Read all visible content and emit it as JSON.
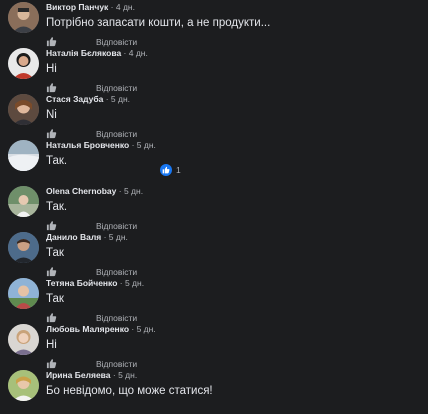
{
  "reply_label": "Відповісти",
  "comments": [
    {
      "author": "Виктор Панчук",
      "time": "4 дн.",
      "text": "Потрібно запасати кошти, а не продукти..."
    },
    {
      "author": "Наталія Бєлякова",
      "time": "4 дн.",
      "text": "Ні"
    },
    {
      "author": "Стася Задуба",
      "time": "5 дн.",
      "text": "Ni"
    },
    {
      "author": "Наталья Бровченко",
      "time": "5 дн.",
      "text": "Так.",
      "reactions": {
        "count": "1",
        "icon": "thumbs-up-icon",
        "color": "#1877f2"
      }
    },
    {
      "author": "Olena Chernobay",
      "time": "5 дн.",
      "text": "Так."
    },
    {
      "author": "Данило Валя",
      "time": "5 дн.",
      "text": "Так"
    },
    {
      "author": "Тетяна Бойченко",
      "time": "5 дн.",
      "text": "Так"
    },
    {
      "author": "Любовь Маляренко",
      "time": "5 дн.",
      "text": "Ні"
    },
    {
      "author": "Ирина Беляева",
      "time": "5 дн.",
      "text": "Бо невідомо, що може статися!"
    }
  ]
}
